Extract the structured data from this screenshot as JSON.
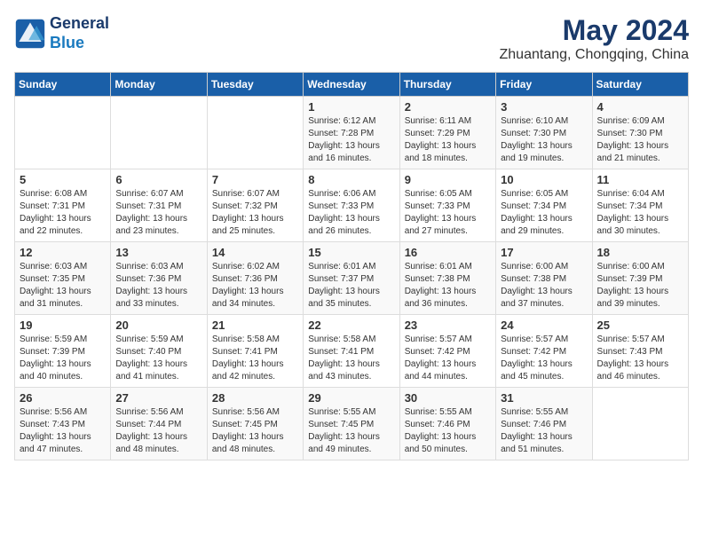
{
  "header": {
    "logo_line1": "General",
    "logo_line2": "Blue",
    "title": "May 2024",
    "subtitle": "Zhuantang, Chongqing, China"
  },
  "days_of_week": [
    "Sunday",
    "Monday",
    "Tuesday",
    "Wednesday",
    "Thursday",
    "Friday",
    "Saturday"
  ],
  "weeks": [
    [
      {
        "day": "",
        "content": ""
      },
      {
        "day": "",
        "content": ""
      },
      {
        "day": "",
        "content": ""
      },
      {
        "day": "1",
        "content": "Sunrise: 6:12 AM\nSunset: 7:28 PM\nDaylight: 13 hours and 16 minutes."
      },
      {
        "day": "2",
        "content": "Sunrise: 6:11 AM\nSunset: 7:29 PM\nDaylight: 13 hours and 18 minutes."
      },
      {
        "day": "3",
        "content": "Sunrise: 6:10 AM\nSunset: 7:30 PM\nDaylight: 13 hours and 19 minutes."
      },
      {
        "day": "4",
        "content": "Sunrise: 6:09 AM\nSunset: 7:30 PM\nDaylight: 13 hours and 21 minutes."
      }
    ],
    [
      {
        "day": "5",
        "content": "Sunrise: 6:08 AM\nSunset: 7:31 PM\nDaylight: 13 hours and 22 minutes."
      },
      {
        "day": "6",
        "content": "Sunrise: 6:07 AM\nSunset: 7:31 PM\nDaylight: 13 hours and 23 minutes."
      },
      {
        "day": "7",
        "content": "Sunrise: 6:07 AM\nSunset: 7:32 PM\nDaylight: 13 hours and 25 minutes."
      },
      {
        "day": "8",
        "content": "Sunrise: 6:06 AM\nSunset: 7:33 PM\nDaylight: 13 hours and 26 minutes."
      },
      {
        "day": "9",
        "content": "Sunrise: 6:05 AM\nSunset: 7:33 PM\nDaylight: 13 hours and 27 minutes."
      },
      {
        "day": "10",
        "content": "Sunrise: 6:05 AM\nSunset: 7:34 PM\nDaylight: 13 hours and 29 minutes."
      },
      {
        "day": "11",
        "content": "Sunrise: 6:04 AM\nSunset: 7:34 PM\nDaylight: 13 hours and 30 minutes."
      }
    ],
    [
      {
        "day": "12",
        "content": "Sunrise: 6:03 AM\nSunset: 7:35 PM\nDaylight: 13 hours and 31 minutes."
      },
      {
        "day": "13",
        "content": "Sunrise: 6:03 AM\nSunset: 7:36 PM\nDaylight: 13 hours and 33 minutes."
      },
      {
        "day": "14",
        "content": "Sunrise: 6:02 AM\nSunset: 7:36 PM\nDaylight: 13 hours and 34 minutes."
      },
      {
        "day": "15",
        "content": "Sunrise: 6:01 AM\nSunset: 7:37 PM\nDaylight: 13 hours and 35 minutes."
      },
      {
        "day": "16",
        "content": "Sunrise: 6:01 AM\nSunset: 7:38 PM\nDaylight: 13 hours and 36 minutes."
      },
      {
        "day": "17",
        "content": "Sunrise: 6:00 AM\nSunset: 7:38 PM\nDaylight: 13 hours and 37 minutes."
      },
      {
        "day": "18",
        "content": "Sunrise: 6:00 AM\nSunset: 7:39 PM\nDaylight: 13 hours and 39 minutes."
      }
    ],
    [
      {
        "day": "19",
        "content": "Sunrise: 5:59 AM\nSunset: 7:39 PM\nDaylight: 13 hours and 40 minutes."
      },
      {
        "day": "20",
        "content": "Sunrise: 5:59 AM\nSunset: 7:40 PM\nDaylight: 13 hours and 41 minutes."
      },
      {
        "day": "21",
        "content": "Sunrise: 5:58 AM\nSunset: 7:41 PM\nDaylight: 13 hours and 42 minutes."
      },
      {
        "day": "22",
        "content": "Sunrise: 5:58 AM\nSunset: 7:41 PM\nDaylight: 13 hours and 43 minutes."
      },
      {
        "day": "23",
        "content": "Sunrise: 5:57 AM\nSunset: 7:42 PM\nDaylight: 13 hours and 44 minutes."
      },
      {
        "day": "24",
        "content": "Sunrise: 5:57 AM\nSunset: 7:42 PM\nDaylight: 13 hours and 45 minutes."
      },
      {
        "day": "25",
        "content": "Sunrise: 5:57 AM\nSunset: 7:43 PM\nDaylight: 13 hours and 46 minutes."
      }
    ],
    [
      {
        "day": "26",
        "content": "Sunrise: 5:56 AM\nSunset: 7:43 PM\nDaylight: 13 hours and 47 minutes."
      },
      {
        "day": "27",
        "content": "Sunrise: 5:56 AM\nSunset: 7:44 PM\nDaylight: 13 hours and 48 minutes."
      },
      {
        "day": "28",
        "content": "Sunrise: 5:56 AM\nSunset: 7:45 PM\nDaylight: 13 hours and 48 minutes."
      },
      {
        "day": "29",
        "content": "Sunrise: 5:55 AM\nSunset: 7:45 PM\nDaylight: 13 hours and 49 minutes."
      },
      {
        "day": "30",
        "content": "Sunrise: 5:55 AM\nSunset: 7:46 PM\nDaylight: 13 hours and 50 minutes."
      },
      {
        "day": "31",
        "content": "Sunrise: 5:55 AM\nSunset: 7:46 PM\nDaylight: 13 hours and 51 minutes."
      },
      {
        "day": "",
        "content": ""
      }
    ]
  ]
}
